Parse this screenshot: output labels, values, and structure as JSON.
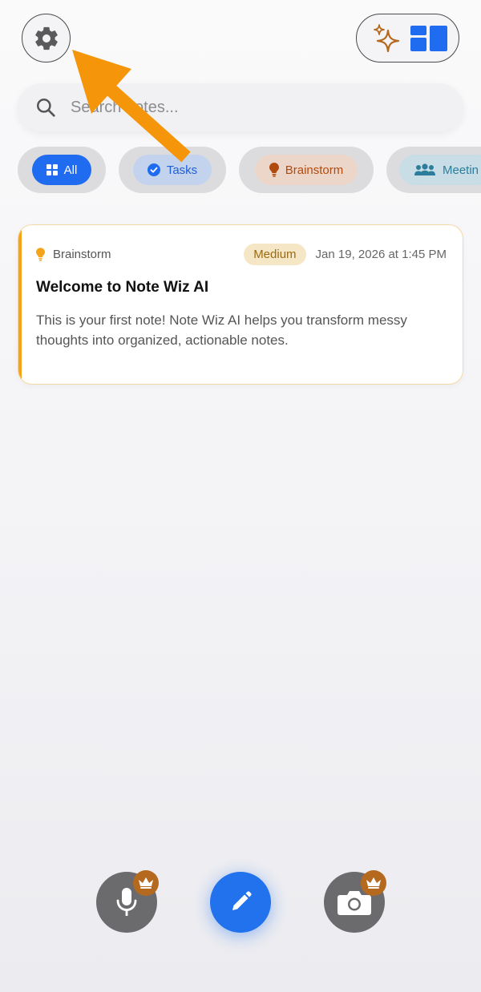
{
  "search": {
    "placeholder": "Search notes..."
  },
  "filters": [
    {
      "label": "All",
      "icon": "grid-icon",
      "selected": true
    },
    {
      "label": "Tasks",
      "icon": "check-circle-icon"
    },
    {
      "label": "Brainstorm",
      "icon": "lightbulb-icon"
    },
    {
      "label": "Meetin",
      "icon": "people-icon"
    }
  ],
  "note": {
    "category": "Brainstorm",
    "priority": "Medium",
    "date": "Jan 19, 2026 at 1:45 PM",
    "title": "Welcome to Note Wiz AI",
    "body": "This is your first note! Note Wiz AI helps you transform messy thoughts into organized, actionable notes."
  },
  "toolbar": {
    "record": {
      "icon": "microphone-icon",
      "premium": true
    },
    "compose": {
      "icon": "pencil-icon"
    },
    "camera": {
      "icon": "camera-icon",
      "premium": true
    }
  },
  "colors": {
    "primary": "#2272ee",
    "accent_orange": "#f5a31a",
    "crown": "#b4691f",
    "annotation_arrow": "#f5960a"
  }
}
